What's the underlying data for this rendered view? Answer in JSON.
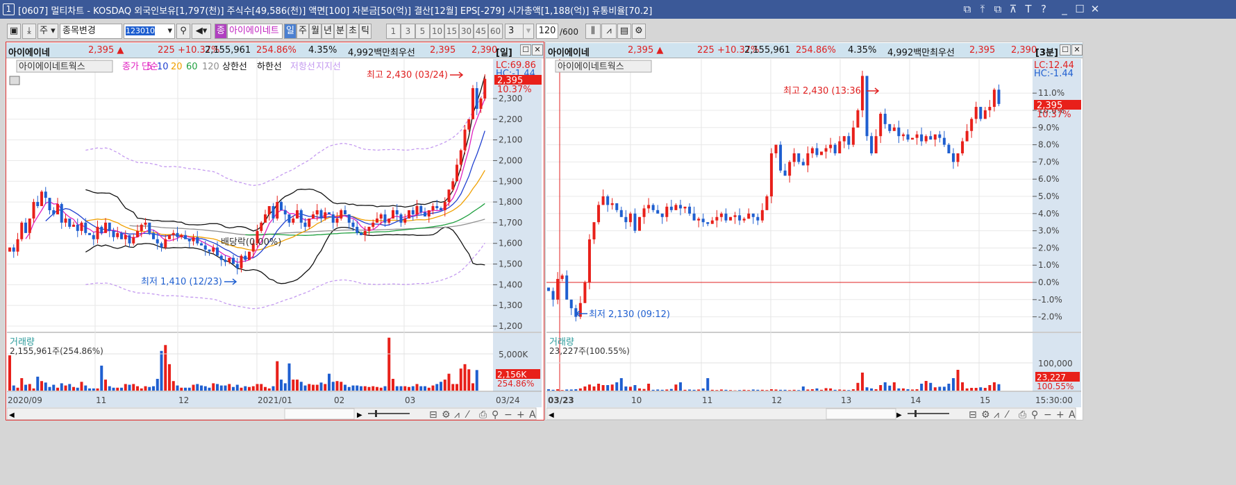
{
  "window": {
    "number": "1",
    "title": "[0607] 멀티차트 - KOSDAQ 외국인보유[1,797(천)] 주식수[49,586(천)] 액면[100] 자본금[50(억)] 결산[12월] EPS[-279] 시가총액[1,188(억)] 유통비율[70.2]",
    "controls": [
      "⧉",
      "⤒",
      "⧉",
      "⊼",
      "T",
      "?",
      "_",
      "☐",
      "✕"
    ]
  },
  "toolbar": {
    "market": "주",
    "stock_change": "종목변경",
    "code": "123010",
    "type_badge": "종",
    "stock_name": "아이에이네트",
    "periods": [
      "일",
      "주",
      "월",
      "년",
      "분",
      "초",
      "틱"
    ],
    "active_period": "일",
    "minute_options": [
      "1",
      "3",
      "5",
      "10",
      "15",
      "30",
      "45",
      "60"
    ],
    "interval": "3",
    "count": "120",
    "count_max": "/600"
  },
  "left": {
    "info": {
      "name": "아이에이네",
      "price": "2,395 ▲",
      "change": "225 +10.37%",
      "volume": "2,155,961",
      "vol_ratio": "254.86%",
      "turnover": "4.35%",
      "amount": "4,992백만",
      "best_label": "최우선",
      "ask": "2,395",
      "bid": "2,390",
      "period": "[일]"
    },
    "legend": {
      "stock": "아이에이네트웍스",
      "ma_label": "종가 단순",
      "ma": [
        "5",
        "10",
        "20",
        "60",
        "120"
      ],
      "upper": "상한선",
      "lower": "하한선",
      "resist": "저항선",
      "support": "지지선"
    },
    "lc": "LC:69.86",
    "hc": "HC:-1.44",
    "cur_price": "2,395",
    "cur_pct": "10.37%",
    "high_note": "최고 2,430 (03/24)",
    "low_note": "최저 1,410 (12/23)",
    "div_note": "배당락(0.00%)",
    "vol_title": "거래량",
    "vol_value": "2,155,961주(254.86%)",
    "vol_tick": "5,000K",
    "vol_cur": "2,156K",
    "vol_pct": "254.86%",
    "dates": [
      "2020/09",
      "11",
      "12",
      "2021/01",
      "02",
      "03"
    ],
    "last_date": "03/24"
  },
  "right": {
    "info": {
      "name": "아이에이네",
      "price": "2,395 ▲",
      "change": "225 +10.37%",
      "volume": "2,155,961",
      "vol_ratio": "254.86%",
      "turnover": "4.35%",
      "amount": "4,992백만",
      "best_label": "최우선",
      "ask": "2,395",
      "bid": "2,390",
      "period": "[3분]"
    },
    "legend": {
      "stock": "아이에이네트웍스"
    },
    "lc": "LC:12.44",
    "hc": "HC:-1.44",
    "cur_price": "2,395",
    "cur_pct": "10.37%",
    "high_note": "최고 2,430 (13:36)",
    "low_note": "최저 2,130 (09:12)",
    "vol_title": "거래량",
    "vol_value": "23,227주(100.55%)",
    "vol_tick": "100,000",
    "vol_cur": "23,227",
    "vol_pct": "100.55%",
    "dates": [
      "03/23",
      "10",
      "11",
      "12",
      "13",
      "14",
      "15"
    ],
    "last_time": "15:30:00"
  },
  "colors": {
    "up": "#e8201a",
    "down": "#1f5fd0",
    "ma5": "#e020c0",
    "ma10": "#2040d0",
    "ma20": "#f0a000",
    "ma60": "#20a040",
    "ma120": "#909090",
    "band": "#111111",
    "envelope": "#c49af0"
  },
  "chart_data": [
    {
      "type": "candlestick",
      "title": "아이에이네트웍스 일봉",
      "price_ticks": [
        1200,
        1300,
        1400,
        1500,
        1600,
        1700,
        1800,
        1900,
        2000,
        2100,
        2200,
        2300
      ],
      "ylim": [
        1200,
        2430
      ],
      "close": [
        1580,
        1560,
        1620,
        1700,
        1650,
        1720,
        1800,
        1780,
        1850,
        1820,
        1760,
        1740,
        1790,
        1700,
        1720,
        1680,
        1690,
        1660,
        1700,
        1650,
        1640,
        1620,
        1680,
        1650,
        1700,
        1660,
        1630,
        1650,
        1620,
        1640,
        1600,
        1630,
        1660,
        1690,
        1700,
        1650,
        1620,
        1600,
        1580,
        1620,
        1640,
        1650,
        1630,
        1640,
        1620,
        1610,
        1630,
        1600,
        1590,
        1570,
        1560,
        1580,
        1540,
        1520,
        1510,
        1530,
        1500,
        1480,
        1540,
        1520,
        1560,
        1600,
        1660,
        1700,
        1740,
        1780,
        1720,
        1800,
        1760,
        1740,
        1700,
        1720,
        1760,
        1700,
        1680,
        1720,
        1740,
        1760,
        1720,
        1750,
        1740,
        1700,
        1720,
        1760,
        1740,
        1700,
        1680,
        1650,
        1640,
        1660,
        1680,
        1700,
        1720,
        1740,
        1700,
        1720,
        1760,
        1740,
        1700,
        1720,
        1760,
        1740,
        1780,
        1750,
        1730,
        1760,
        1780,
        1770,
        1760,
        1800,
        1860,
        1900,
        1980,
        2050,
        2150,
        2200,
        2350,
        2250,
        2300,
        2395
      ],
      "volume_k": [
        4800,
        700,
        400,
        1700,
        800,
        900,
        300,
        1900,
        1300,
        1100,
        500,
        800,
        400,
        1000,
        700,
        900,
        500,
        400,
        1200,
        700,
        300,
        300,
        300,
        3400,
        1500,
        600,
        400,
        400,
        400,
        900,
        800,
        900,
        600,
        300,
        600,
        500,
        600,
        1600,
        5400,
        6200,
        3600,
        1300,
        700,
        400,
        400,
        400,
        800,
        900,
        700,
        600,
        400,
        1000,
        900,
        700,
        700,
        900,
        500,
        800,
        400,
        600,
        500,
        600,
        900,
        900,
        500,
        300,
        600,
        4000,
        1500,
        1000,
        3700,
        1500,
        1500,
        1200,
        700,
        900,
        800,
        800,
        1100,
        900,
        2300,
        1200,
        1300,
        1200,
        800,
        500,
        700,
        700,
        600,
        600,
        500,
        600,
        500,
        400,
        600,
        7200,
        1600,
        600,
        600,
        600,
        500,
        600,
        900,
        600,
        600,
        400,
        700,
        900,
        1200,
        1500,
        2300,
        900,
        900,
        3000,
        3600,
        2900,
        1000,
        2800
      ]
    },
    {
      "type": "candlestick",
      "title": "아이에이네트웍스 3분봉",
      "pct_ticks": [
        -2,
        -1,
        0,
        1,
        2,
        3,
        4,
        5,
        6,
        7,
        8,
        9,
        10,
        11
      ],
      "base_price": 2170,
      "close_pct": [
        -0.5,
        -1.0,
        0.2,
        0.4,
        -1.0,
        -1.5,
        -2.0,
        -1.2,
        0.0,
        2.5,
        3.5,
        4.5,
        5.0,
        4.5,
        4.6,
        4.2,
        3.8,
        3.5,
        4.0,
        3.0,
        3.8,
        4.3,
        4.5,
        4.2,
        4.0,
        3.8,
        4.4,
        4.2,
        4.5,
        4.3,
        4.4,
        4.0,
        3.6,
        3.7,
        3.5,
        3.4,
        3.6,
        3.8,
        4.0,
        3.6,
        3.8,
        3.9,
        3.6,
        3.7,
        4.0,
        3.8,
        3.6,
        4.2,
        5.0,
        7.5,
        8.0,
        6.5,
        6.2,
        7.0,
        7.5,
        7.0,
        6.8,
        7.5,
        7.8,
        7.4,
        7.6,
        7.8,
        8.0,
        7.5,
        8.2,
        8.5,
        8.0,
        9.0,
        10.0,
        12.0,
        8.5,
        7.5,
        8.5,
        9.8,
        9.2,
        8.8,
        9.0,
        8.5,
        8.6,
        8.3,
        8.4,
        8.6,
        8.2,
        8.5,
        8.3,
        8.6,
        8.4,
        8.0,
        7.5,
        7.0,
        7.5,
        8.2,
        8.8,
        9.5,
        10.2,
        9.5,
        10.0,
        10.2,
        11.2,
        10.37
      ],
      "volume": [
        5000,
        3000,
        5000,
        2000,
        4000,
        4000,
        5000,
        8000,
        15000,
        22000,
        15000,
        25000,
        20000,
        20000,
        22000,
        30000,
        45000,
        15000,
        14000,
        20000,
        8000,
        6000,
        25000,
        3000,
        4000,
        3000,
        4000,
        6000,
        22000,
        30000,
        3000,
        4000,
        3000,
        4000,
        8000,
        45000,
        3000,
        2000,
        4000,
        3000,
        2000,
        1000,
        2000,
        3000,
        2000,
        4000,
        3000,
        3000,
        2000,
        5000,
        4000,
        3000,
        3000,
        2000,
        3000,
        2000,
        15000,
        4000,
        5000,
        8000,
        3000,
        9000,
        8000,
        3000,
        4000,
        3000,
        2000,
        5000,
        28000,
        65000,
        12000,
        8000,
        5000,
        20000,
        30000,
        18000,
        30000,
        8000,
        8000,
        5000,
        4000,
        5000,
        25000,
        35000,
        28000,
        12000,
        14000,
        14000,
        25000,
        45000,
        75000,
        30000,
        8000,
        10000,
        10000,
        12000,
        10000,
        20000,
        30000,
        23227
      ]
    }
  ]
}
